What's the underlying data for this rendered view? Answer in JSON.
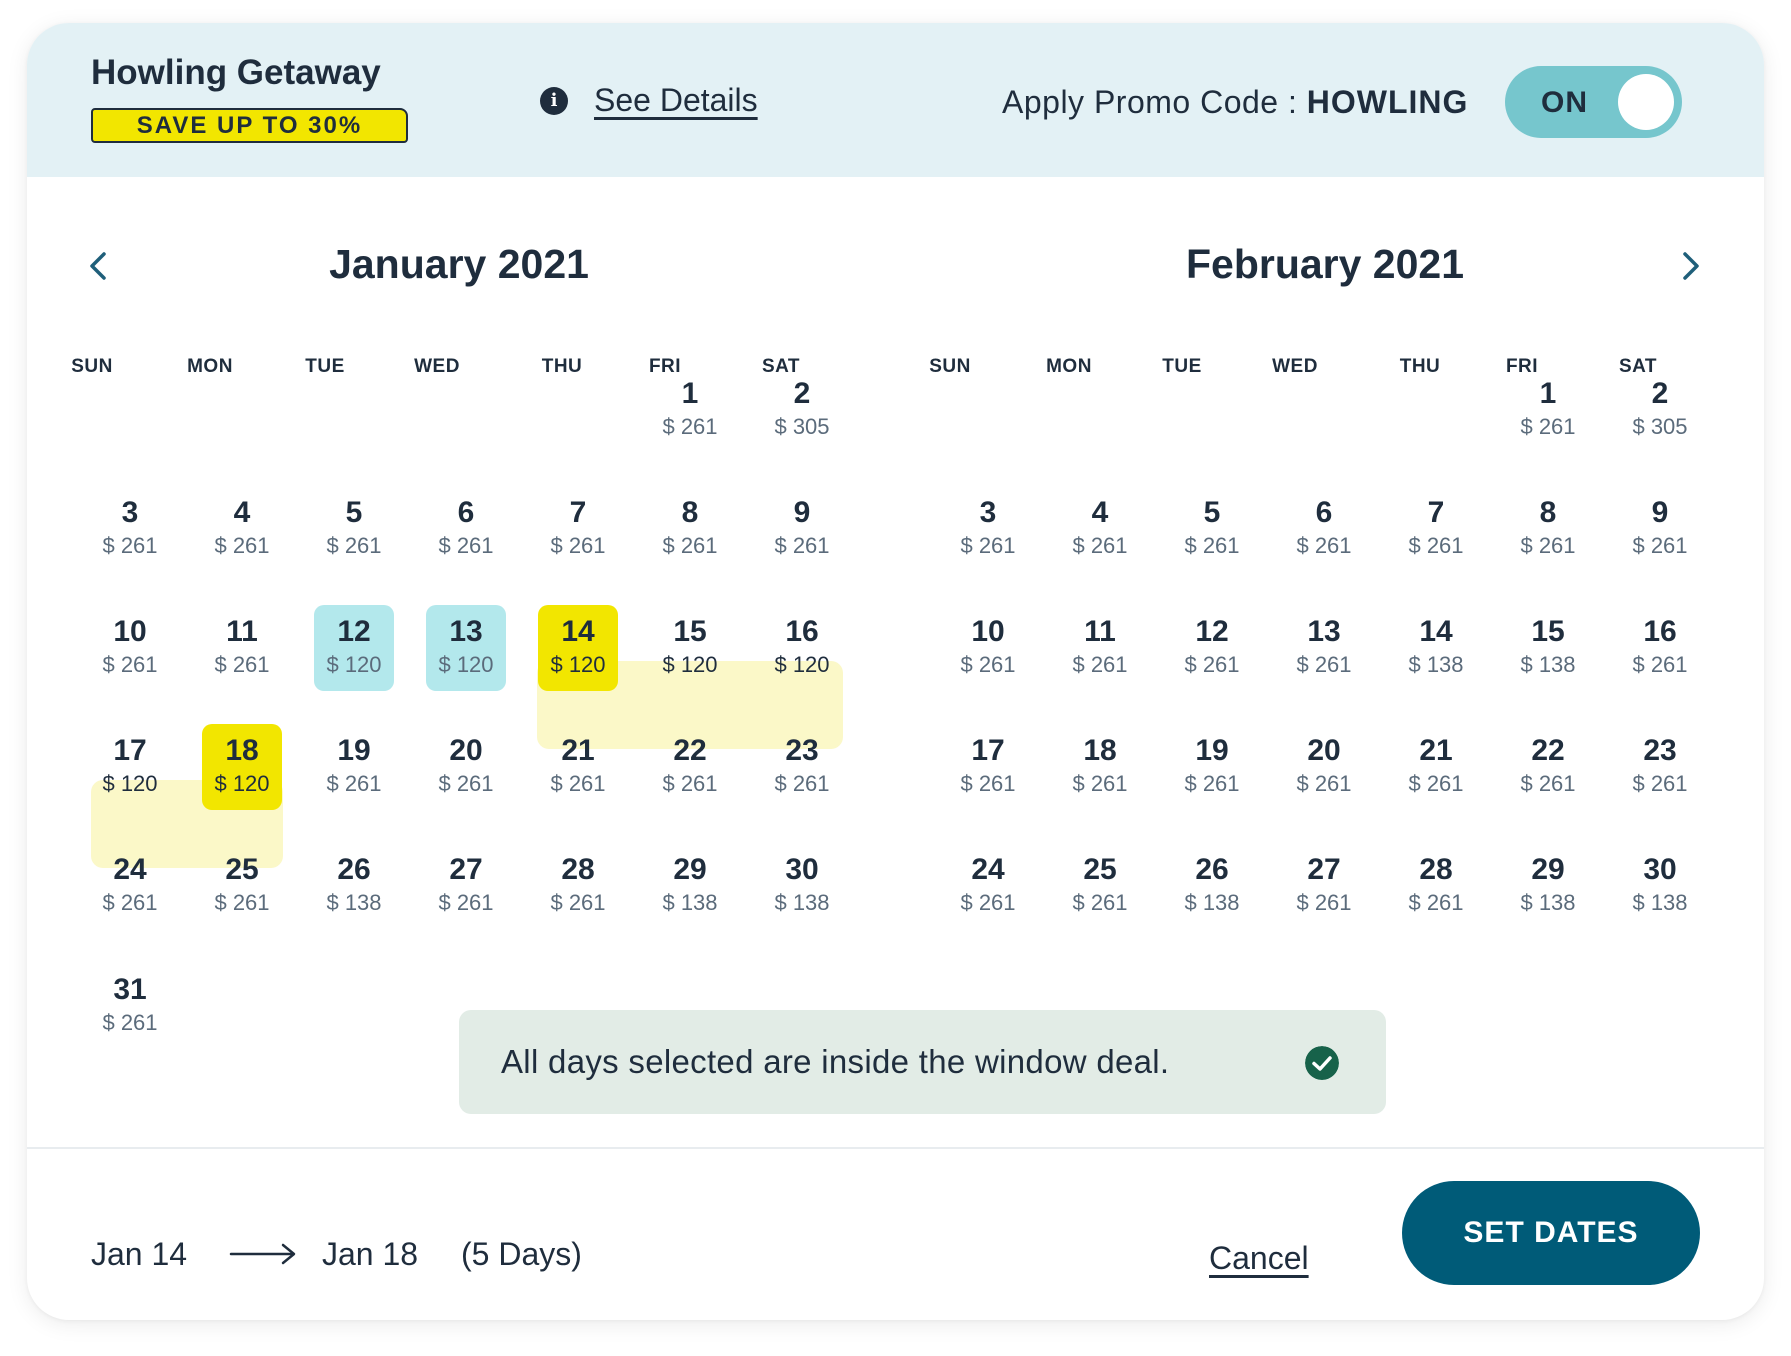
{
  "header": {
    "deal_title": "Howling Getaway",
    "deal_badge": "SAVE UP TO 30%",
    "see_details": "See Details",
    "promo_label": "Apply Promo Code : ",
    "promo_code": "HOWLING",
    "toggle_label": "ON"
  },
  "weekdays": [
    "SUN",
    "MON",
    "TUE",
    "WED",
    "THU",
    "FRI",
    "SAT"
  ],
  "months": [
    {
      "title": "January 2021",
      "first_weekday": 5,
      "days": [
        {
          "n": "1",
          "price": "$ 261"
        },
        {
          "n": "2",
          "price": "$ 305"
        },
        {
          "n": "3",
          "price": "$ 261"
        },
        {
          "n": "4",
          "price": "$ 261"
        },
        {
          "n": "5",
          "price": "$ 261"
        },
        {
          "n": "6",
          "price": "$ 261"
        },
        {
          "n": "7",
          "price": "$ 261"
        },
        {
          "n": "8",
          "price": "$ 261"
        },
        {
          "n": "9",
          "price": "$ 261"
        },
        {
          "n": "10",
          "price": "$ 261"
        },
        {
          "n": "11",
          "price": "$ 261"
        },
        {
          "n": "12",
          "price": "$ 120",
          "state": "promo"
        },
        {
          "n": "13",
          "price": "$ 120",
          "state": "promo"
        },
        {
          "n": "14",
          "price": "$ 120",
          "state": "selected"
        },
        {
          "n": "15",
          "price": "$ 120",
          "state": "range"
        },
        {
          "n": "16",
          "price": "$ 120",
          "state": "range"
        },
        {
          "n": "17",
          "price": "$ 120",
          "state": "range"
        },
        {
          "n": "18",
          "price": "$ 120",
          "state": "selected"
        },
        {
          "n": "19",
          "price": "$ 261"
        },
        {
          "n": "20",
          "price": "$ 261"
        },
        {
          "n": "21",
          "price": "$ 261"
        },
        {
          "n": "22",
          "price": "$ 261"
        },
        {
          "n": "23",
          "price": "$ 261"
        },
        {
          "n": "24",
          "price": "$ 261"
        },
        {
          "n": "25",
          "price": "$ 261"
        },
        {
          "n": "26",
          "price": "$ 138"
        },
        {
          "n": "27",
          "price": "$ 261"
        },
        {
          "n": "28",
          "price": "$ 261"
        },
        {
          "n": "29",
          "price": "$ 138"
        },
        {
          "n": "30",
          "price": "$ 138"
        },
        {
          "n": "31",
          "price": "$ 261"
        }
      ]
    },
    {
      "title": "February 2021",
      "first_weekday": 5,
      "days": [
        {
          "n": "1",
          "price": "$ 261"
        },
        {
          "n": "2",
          "price": "$ 305"
        },
        {
          "n": "3",
          "price": "$ 261"
        },
        {
          "n": "4",
          "price": "$ 261"
        },
        {
          "n": "5",
          "price": "$ 261"
        },
        {
          "n": "6",
          "price": "$ 261"
        },
        {
          "n": "7",
          "price": "$ 261"
        },
        {
          "n": "8",
          "price": "$ 261"
        },
        {
          "n": "9",
          "price": "$ 261"
        },
        {
          "n": "10",
          "price": "$ 261"
        },
        {
          "n": "11",
          "price": "$ 261"
        },
        {
          "n": "12",
          "price": "$ 261"
        },
        {
          "n": "13",
          "price": "$ 261"
        },
        {
          "n": "14",
          "price": "$ 138"
        },
        {
          "n": "15",
          "price": "$ 138"
        },
        {
          "n": "16",
          "price": "$ 261"
        },
        {
          "n": "17",
          "price": "$ 261"
        },
        {
          "n": "18",
          "price": "$ 261"
        },
        {
          "n": "19",
          "price": "$ 261"
        },
        {
          "n": "20",
          "price": "$ 261"
        },
        {
          "n": "21",
          "price": "$ 261"
        },
        {
          "n": "22",
          "price": "$ 261"
        },
        {
          "n": "23",
          "price": "$ 261"
        },
        {
          "n": "24",
          "price": "$ 261"
        },
        {
          "n": "25",
          "price": "$ 261"
        },
        {
          "n": "26",
          "price": "$ 138"
        },
        {
          "n": "27",
          "price": "$ 261"
        },
        {
          "n": "28",
          "price": "$ 261"
        },
        {
          "n": "29",
          "price": "$ 138"
        },
        {
          "n": "30",
          "price": "$ 138"
        }
      ]
    }
  ],
  "toast": {
    "message": "All days selected are inside the window deal."
  },
  "footer": {
    "from": "Jan 14",
    "to": "Jan 18",
    "days": "(5 Days)",
    "cancel": "Cancel",
    "set_dates": "SET DATES"
  },
  "colors": {
    "header_bg": "#e3f1f5",
    "badge_yellow": "#f2e600",
    "toggle_teal": "#76c6cd",
    "promo_day": "#b3e8ec",
    "range_band": "#fbf8c8",
    "toast_bg": "#e2ece6",
    "check_green": "#17624a",
    "primary_button": "#005b78",
    "text_dark": "#1f2d3d"
  },
  "icons": {
    "info": "info-icon",
    "prev": "chevron-left-icon",
    "next": "chevron-right-icon",
    "check": "check-circle-icon",
    "range_arrow": "arrow-right-icon"
  }
}
